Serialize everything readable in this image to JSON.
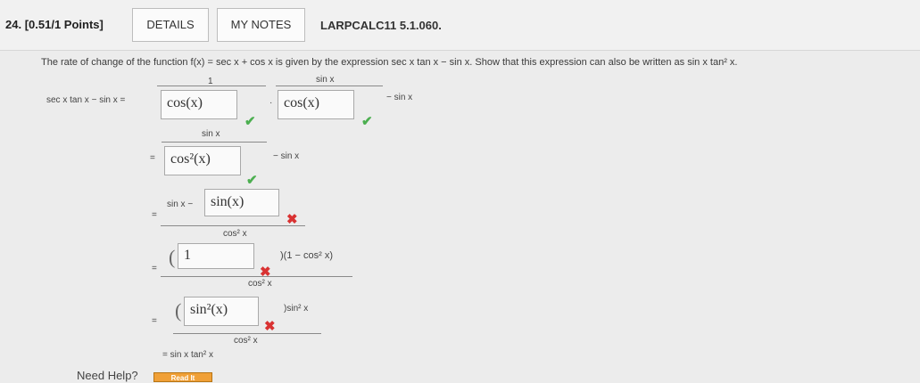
{
  "header": {
    "question_number": "24.",
    "points": "[0.51/1 Points]",
    "details_label": "DETAILS",
    "notes_label": "MY NOTES",
    "problem_code": "LARPCALC11 5.1.060."
  },
  "prompt": "The rate of change of the function f(x) = sec x + cos x is given by the expression sec x tan x − sin x. Show that this expression can also be written as sin x tan² x.",
  "steps": {
    "lhs": "sec x tan x − sin x =",
    "eq": "=",
    "s1_num1": "1",
    "s1_box1": "cos(x)",
    "s1_dot": "·",
    "s1_num2": "sin x",
    "s1_box2": "cos(x)",
    "s1_tail": "− sin x",
    "s2_num": "sin x",
    "s2_box": "cos²(x)",
    "s2_tail": "− sin x",
    "s3_num_prefix": "sin x −",
    "s3_box": "sin(x)",
    "s3_den": "cos² x",
    "s4_box": "1",
    "s4_tail": "(1 − cos² x)",
    "s4_den": "cos² x",
    "s5_box": "sin²(x)",
    "s5_tail": "sin² x",
    "s5_den": "cos² x",
    "final": "= sin x tan² x"
  },
  "footer": {
    "need_help": "Need Help?",
    "read_it": "Read It"
  },
  "colors": {
    "correct": "#4caf50",
    "incorrect": "#d93232",
    "read_button": "#f0a037"
  }
}
